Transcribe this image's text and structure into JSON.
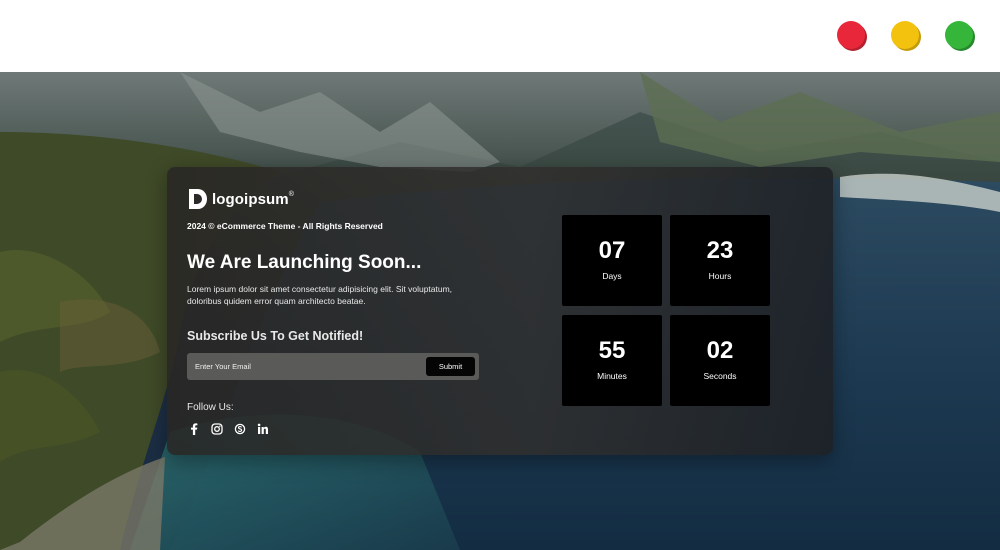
{
  "window_controls": {
    "close_color": "#e8283a",
    "minimize_color": "#f2c20f",
    "maximize_color": "#35b53a"
  },
  "brand": {
    "name": "logoipsum",
    "mark": "®"
  },
  "copyright": "2024 © eCommerce Theme - All Rights Reserved",
  "headline": "We Are Launching Soon...",
  "description": "Lorem ipsum dolor sit amet consectetur adipisicing elit. Sit voluptatum, doloribus quidem error quam architecto beatae.",
  "subscribe": {
    "title": "Subscribe Us To Get Notified!",
    "placeholder": "Enter Your Email",
    "button": "Submit"
  },
  "follow": {
    "label": "Follow Us:",
    "icons": [
      "facebook-icon",
      "instagram-icon",
      "skype-icon",
      "linkedin-icon"
    ]
  },
  "countdown": {
    "days": {
      "value": "07",
      "label": "Days"
    },
    "hours": {
      "value": "23",
      "label": "Hours"
    },
    "minutes": {
      "value": "55",
      "label": "Minutes"
    },
    "seconds": {
      "value": "02",
      "label": "Seconds"
    }
  }
}
